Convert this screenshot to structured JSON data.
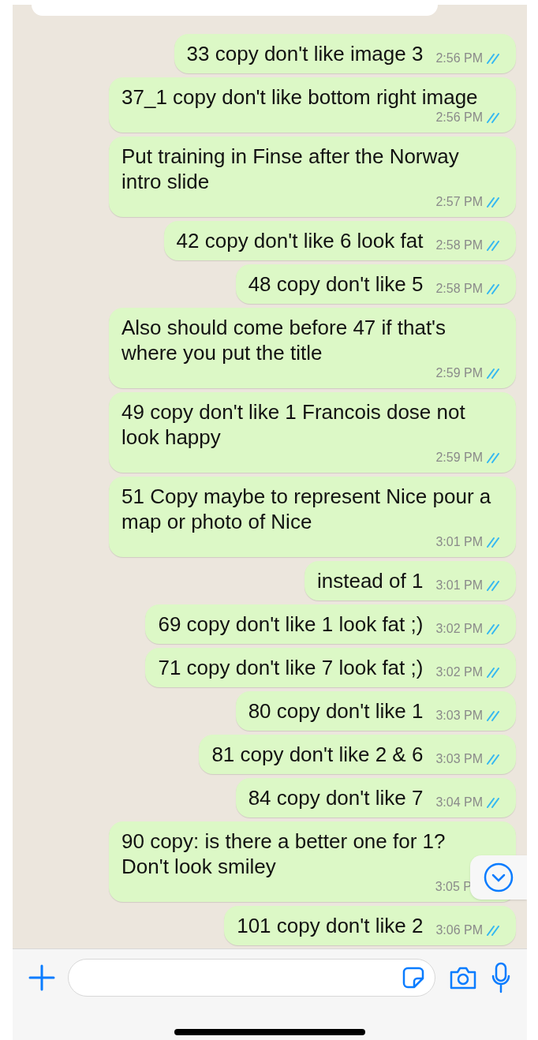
{
  "messages": [
    {
      "text": "33 copy don't like image 3",
      "time": "2:56 PM",
      "read": true
    },
    {
      "text": "37_1 copy don't like bottom right image",
      "time": "2:56 PM",
      "read": true
    },
    {
      "text": "Put training in Finse after the Norway intro slide",
      "time": "2:57 PM",
      "read": true
    },
    {
      "text": "42 copy don't like 6 look fat",
      "time": "2:58 PM",
      "read": true
    },
    {
      "text": "48 copy don't like 5",
      "time": "2:58 PM",
      "read": true
    },
    {
      "text": "Also should come before 47 if that's where you put the title",
      "time": "2:59 PM",
      "read": true
    },
    {
      "text": "49 copy don't like 1 Francois dose not look happy",
      "time": "2:59 PM",
      "read": true
    },
    {
      "text": "51 Copy maybe to represent Nice pour a map or photo of Nice",
      "time": "3:01 PM",
      "read": true
    },
    {
      "text": "instead of 1",
      "time": "3:01 PM",
      "read": true
    },
    {
      "text": "69 copy don't like 1 look fat ;)",
      "time": "3:02 PM",
      "read": true
    },
    {
      "text": "71 copy don't like 7 look fat ;)",
      "time": "3:02 PM",
      "read": true
    },
    {
      "text": "80 copy don't like 1",
      "time": "3:03 PM",
      "read": true
    },
    {
      "text": "81 copy don't like 2 & 6",
      "time": "3:03 PM",
      "read": true
    },
    {
      "text": "84 copy don't like 7",
      "time": "3:04 PM",
      "read": true
    },
    {
      "text": "90 copy: is there a better one for 1?\nDon't look smiley",
      "time": "3:05 P"
    },
    {
      "text": "101 copy don't like 2",
      "time": "3:06 PM",
      "read": true
    }
  ]
}
